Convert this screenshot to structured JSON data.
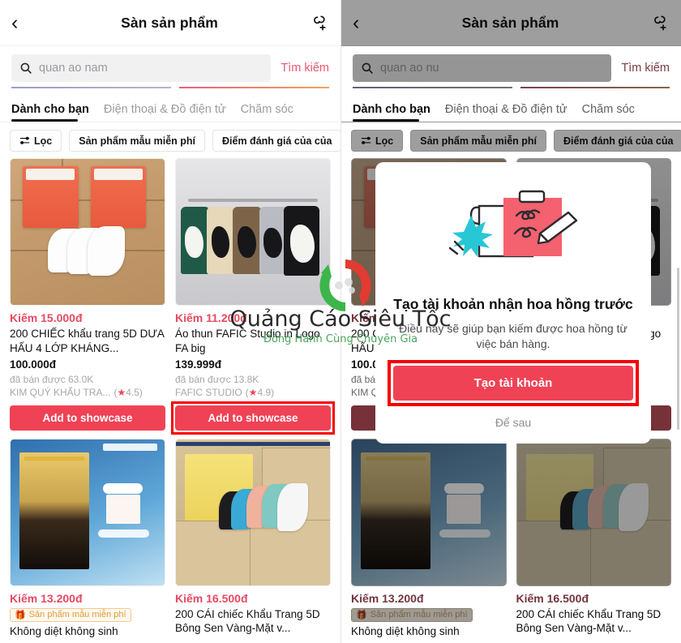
{
  "app": {
    "header": {
      "back_icon": "chevron-left-icon",
      "title": "Sàn sản phẩm",
      "action_icon": "add-link-icon"
    },
    "search": {
      "icon": "search-icon",
      "left_value": "quan ao nam",
      "right_value": "quan ao nu",
      "button_label": "Tìm kiếm"
    },
    "tabs": [
      {
        "label": "Dành cho bạn",
        "active": true
      },
      {
        "label": "Điện thoại & Đồ điện tử",
        "active": false
      },
      {
        "label": "Chăm sóc",
        "active": false
      }
    ],
    "chips": [
      {
        "label": "Lọc",
        "icon": "filter-icon"
      },
      {
        "label": "Sản phẩm mẫu miễn phí",
        "icon": ""
      },
      {
        "label": "Điểm đánh giá của của",
        "icon": ""
      }
    ],
    "cta_label": "Add to showcase",
    "products": [
      {
        "earn": "Kiếm 15.000đ",
        "title": "200 CHIẾC khẩu trang 5D DƯA HẤU 4 LỚP KHÁNG...",
        "price": "100.000đ",
        "sold": "đã bán được 63.0K",
        "shop": "KIM QUÝ KHẨU TRA...",
        "rating": "4.5",
        "free_sample": false,
        "highlighted": false
      },
      {
        "earn": "Kiếm 11.200đ",
        "title": "Áo thun FAFIC Studio in Logo FA big",
        "price": "139.999đ",
        "sold": "đã bán được 13.8K",
        "shop": "FAFIC STUDIO",
        "rating": "4.9",
        "free_sample": false,
        "highlighted": true
      },
      {
        "earn": "Kiếm 13.200đ",
        "title": "Không diệt không sinh",
        "price": "",
        "sold": "",
        "shop": "",
        "rating": "",
        "free_sample": true,
        "free_sample_label": "Sản phẩm mẫu miễn phí",
        "highlighted": false
      },
      {
        "earn": "Kiếm 16.500đ",
        "title": "200 CÁI chiếc Khẩu Trang 5D Bông Sen Vàng-Mặt v...",
        "price": "",
        "sold": "",
        "shop": "",
        "rating": "",
        "free_sample": false,
        "highlighted": false
      }
    ],
    "modal": {
      "illustration": "clipboard-signature-illustration",
      "title": "Tạo tài khoản nhận hoa hồng trước",
      "description": "Điều này sẽ giúp bạn kiếm được hoa hồng từ việc bán hàng.",
      "primary_label": "Tạo tài khoản",
      "secondary_label": "Để sau"
    },
    "watermark": {
      "text": "Quảng Cáo Siêu Tốc",
      "subtext": "Đồng Hành Cùng Chuyên Gia"
    },
    "colors": {
      "accent_red": "#f04255",
      "earn_red": "#e64a60",
      "highlight_red": "#f40000",
      "badge_orange": "#e09a3c",
      "watermark_green": "#4aa65c"
    }
  }
}
